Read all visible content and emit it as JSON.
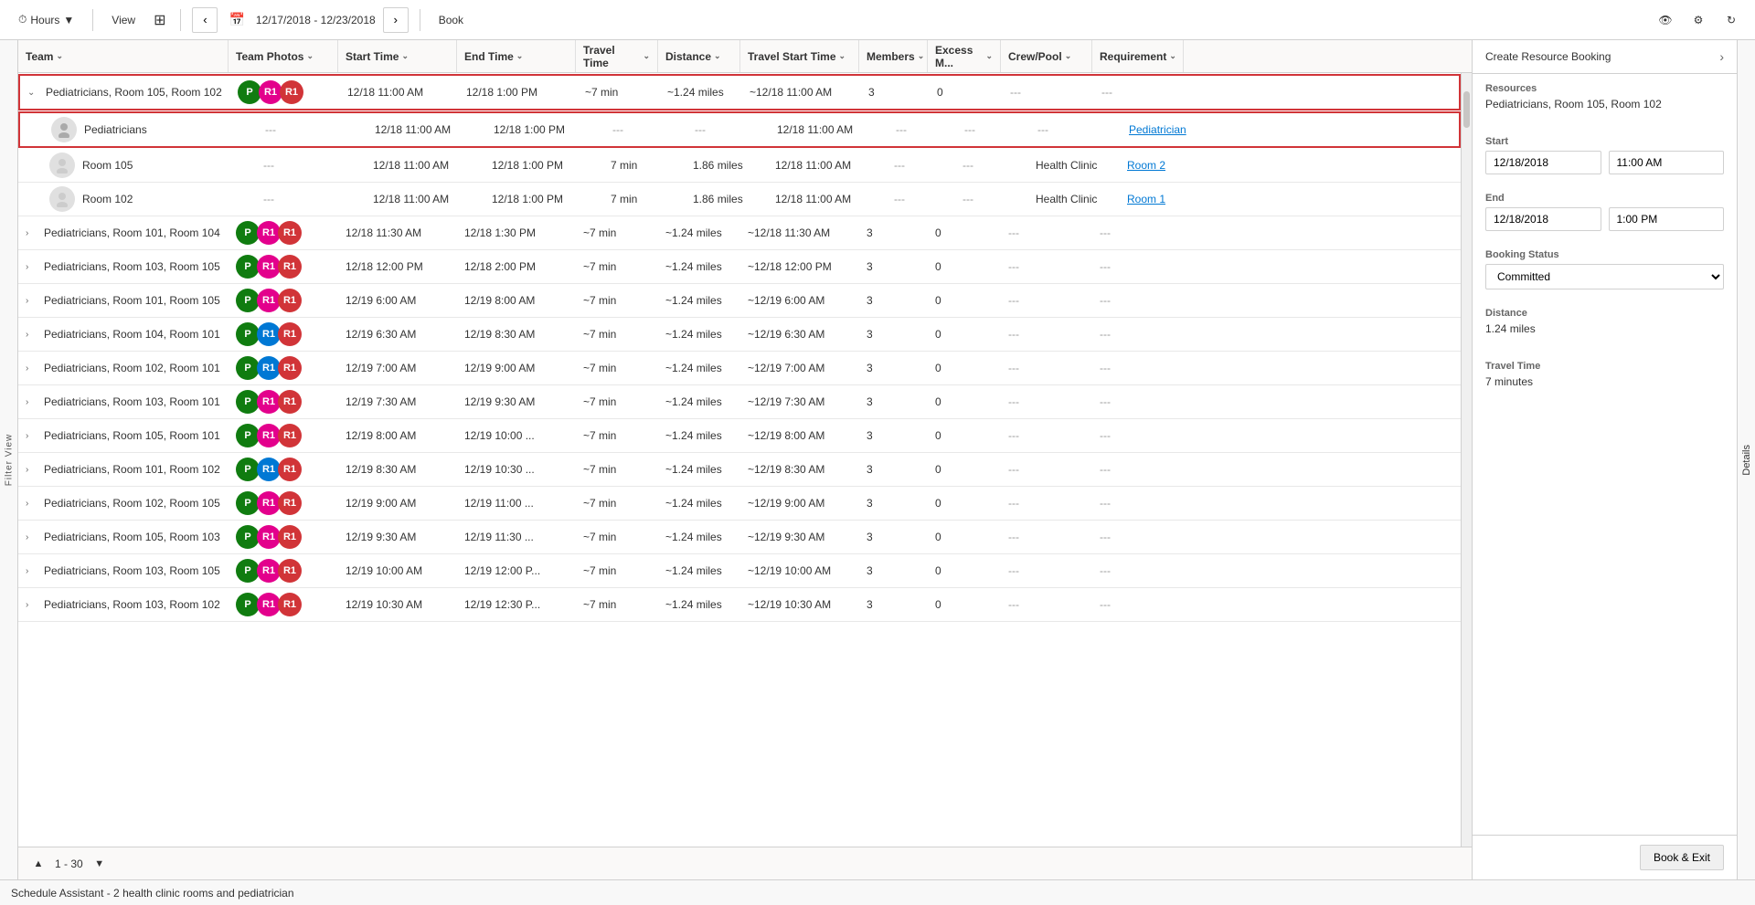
{
  "toolbar": {
    "hours_label": "Hours",
    "view_label": "View",
    "date_range": "12/17/2018 - 12/23/2018",
    "book_label": "Book",
    "prev_title": "Previous",
    "next_title": "Next"
  },
  "filter": {
    "label": "Filter View"
  },
  "grid": {
    "columns": [
      {
        "key": "team",
        "label": "Team"
      },
      {
        "key": "photos",
        "label": "Team Photos"
      },
      {
        "key": "start",
        "label": "Start Time"
      },
      {
        "key": "end",
        "label": "End Time"
      },
      {
        "key": "travel",
        "label": "Travel Time"
      },
      {
        "key": "distance",
        "label": "Distance"
      },
      {
        "key": "travelstart",
        "label": "Travel Start Time"
      },
      {
        "key": "members",
        "label": "Members"
      },
      {
        "key": "excess",
        "label": "Excess M..."
      },
      {
        "key": "crew",
        "label": "Crew/Pool"
      },
      {
        "key": "req",
        "label": "Requirement"
      }
    ],
    "rows": [
      {
        "id": "row1",
        "type": "group",
        "expanded": true,
        "team": "Pediatricians, Room 105, Room 102",
        "avatars": [
          {
            "color": "green",
            "letter": "P"
          },
          {
            "color": "pink",
            "letter": "R1"
          },
          {
            "color": "red",
            "letter": "R1"
          }
        ],
        "start": "12/18 11:00 AM",
        "end": "12/18 1:00 PM",
        "travel": "~7 min",
        "distance": "~1.24 miles",
        "travelstart": "~12/18 11:00 AM",
        "members": "3",
        "excess": "0",
        "crew": "---",
        "req": "---",
        "children": [
          {
            "id": "row1a",
            "type": "child-selected",
            "team": "Pediatricians",
            "avatars": [],
            "start": "12/18 11:00 AM",
            "end": "12/18 1:00 PM",
            "travel": "---",
            "distance": "---",
            "travelstart": "12/18 11:00 AM",
            "members": "---",
            "excess": "---",
            "crew": "---",
            "req": "Pediatrician",
            "req_link": true
          },
          {
            "id": "row1b",
            "type": "child",
            "team": "Room 105",
            "avatars": [],
            "start": "12/18 11:00 AM",
            "end": "12/18 1:00 PM",
            "travel": "7 min",
            "distance": "1.86 miles",
            "travelstart": "12/18 11:00 AM",
            "members": "---",
            "excess": "---",
            "crew": "Health Clinic",
            "req": "Room 2",
            "req_link": true
          },
          {
            "id": "row1c",
            "type": "child",
            "team": "Room 102",
            "avatars": [],
            "start": "12/18 11:00 AM",
            "end": "12/18 1:00 PM",
            "travel": "7 min",
            "distance": "1.86 miles",
            "travelstart": "12/18 11:00 AM",
            "members": "---",
            "excess": "---",
            "crew": "Health Clinic",
            "req": "Room 1",
            "req_link": true
          }
        ]
      },
      {
        "id": "row2",
        "type": "group",
        "expanded": false,
        "team": "Pediatricians, Room 101, Room 104",
        "avatars": [
          {
            "color": "green",
            "letter": "P"
          },
          {
            "color": "pink",
            "letter": "R1"
          },
          {
            "color": "red",
            "letter": "R1"
          }
        ],
        "start": "12/18 11:30 AM",
        "end": "12/18 1:30 PM",
        "travel": "~7 min",
        "distance": "~1.24 miles",
        "travelstart": "~12/18 11:30 AM",
        "members": "3",
        "excess": "0",
        "crew": "---",
        "req": "---"
      },
      {
        "id": "row3",
        "type": "group",
        "expanded": false,
        "team": "Pediatricians, Room 103, Room 105",
        "avatars": [
          {
            "color": "green",
            "letter": "P"
          },
          {
            "color": "pink",
            "letter": "R1"
          },
          {
            "color": "red",
            "letter": "R1"
          }
        ],
        "start": "12/18 12:00 PM",
        "end": "12/18 2:00 PM",
        "travel": "~7 min",
        "distance": "~1.24 miles",
        "travelstart": "~12/18 12:00 PM",
        "members": "3",
        "excess": "0",
        "crew": "---",
        "req": "---"
      },
      {
        "id": "row4",
        "type": "group",
        "expanded": false,
        "team": "Pediatricians, Room 101, Room 105",
        "avatars": [
          {
            "color": "green",
            "letter": "P"
          },
          {
            "color": "pink",
            "letter": "R1"
          },
          {
            "color": "red",
            "letter": "R1"
          }
        ],
        "start": "12/19 6:00 AM",
        "end": "12/19 8:00 AM",
        "travel": "~7 min",
        "distance": "~1.24 miles",
        "travelstart": "~12/19 6:00 AM",
        "members": "3",
        "excess": "0",
        "crew": "---",
        "req": "---"
      },
      {
        "id": "row5",
        "type": "group",
        "expanded": false,
        "team": "Pediatricians, Room 104, Room 101",
        "avatars": [
          {
            "color": "green",
            "letter": "P"
          },
          {
            "color": "blue",
            "letter": "R1"
          },
          {
            "color": "red",
            "letter": "R1"
          }
        ],
        "start": "12/19 6:30 AM",
        "end": "12/19 8:30 AM",
        "travel": "~7 min",
        "distance": "~1.24 miles",
        "travelstart": "~12/19 6:30 AM",
        "members": "3",
        "excess": "0",
        "crew": "---",
        "req": "---"
      },
      {
        "id": "row6",
        "type": "group",
        "expanded": false,
        "team": "Pediatricians, Room 102, Room 101",
        "avatars": [
          {
            "color": "green",
            "letter": "P"
          },
          {
            "color": "blue",
            "letter": "R1"
          },
          {
            "color": "red",
            "letter": "R1"
          }
        ],
        "start": "12/19 7:00 AM",
        "end": "12/19 9:00 AM",
        "travel": "~7 min",
        "distance": "~1.24 miles",
        "travelstart": "~12/19 7:00 AM",
        "members": "3",
        "excess": "0",
        "crew": "---",
        "req": "---"
      },
      {
        "id": "row7",
        "type": "group",
        "expanded": false,
        "team": "Pediatricians, Room 103, Room 101",
        "avatars": [
          {
            "color": "green",
            "letter": "P"
          },
          {
            "color": "pink",
            "letter": "R1"
          },
          {
            "color": "red",
            "letter": "R1"
          }
        ],
        "start": "12/19 7:30 AM",
        "end": "12/19 9:30 AM",
        "travel": "~7 min",
        "distance": "~1.24 miles",
        "travelstart": "~12/19 7:30 AM",
        "members": "3",
        "excess": "0",
        "crew": "---",
        "req": "---"
      },
      {
        "id": "row8",
        "type": "group",
        "expanded": false,
        "team": "Pediatricians, Room 105, Room 101",
        "avatars": [
          {
            "color": "green",
            "letter": "P"
          },
          {
            "color": "pink",
            "letter": "R1"
          },
          {
            "color": "red",
            "letter": "R1"
          }
        ],
        "start": "12/19 8:00 AM",
        "end": "12/19 10:00 ...",
        "travel": "~7 min",
        "distance": "~1.24 miles",
        "travelstart": "~12/19 8:00 AM",
        "members": "3",
        "excess": "0",
        "crew": "---",
        "req": "---"
      },
      {
        "id": "row9",
        "type": "group",
        "expanded": false,
        "team": "Pediatricians, Room 101, Room 102",
        "avatars": [
          {
            "color": "green",
            "letter": "P"
          },
          {
            "color": "blue",
            "letter": "R1"
          },
          {
            "color": "red",
            "letter": "R1"
          }
        ],
        "start": "12/19 8:30 AM",
        "end": "12/19 10:30 ...",
        "travel": "~7 min",
        "distance": "~1.24 miles",
        "travelstart": "~12/19 8:30 AM",
        "members": "3",
        "excess": "0",
        "crew": "---",
        "req": "---"
      },
      {
        "id": "row10",
        "type": "group",
        "expanded": false,
        "team": "Pediatricians, Room 102, Room 105",
        "avatars": [
          {
            "color": "green",
            "letter": "P"
          },
          {
            "color": "pink",
            "letter": "R1"
          },
          {
            "color": "red",
            "letter": "R1"
          }
        ],
        "start": "12/19 9:00 AM",
        "end": "12/19 11:00 ...",
        "travel": "~7 min",
        "distance": "~1.24 miles",
        "travelstart": "~12/19 9:00 AM",
        "members": "3",
        "excess": "0",
        "crew": "---",
        "req": "---"
      },
      {
        "id": "row11",
        "type": "group",
        "expanded": false,
        "team": "Pediatricians, Room 105, Room 103",
        "avatars": [
          {
            "color": "green",
            "letter": "P"
          },
          {
            "color": "pink",
            "letter": "R1"
          },
          {
            "color": "red",
            "letter": "R1"
          }
        ],
        "start": "12/19 9:30 AM",
        "end": "12/19 11:30 ...",
        "travel": "~7 min",
        "distance": "~1.24 miles",
        "travelstart": "~12/19 9:30 AM",
        "members": "3",
        "excess": "0",
        "crew": "---",
        "req": "---"
      },
      {
        "id": "row12",
        "type": "group",
        "expanded": false,
        "team": "Pediatricians, Room 103, Room 105",
        "avatars": [
          {
            "color": "green",
            "letter": "P"
          },
          {
            "color": "pink",
            "letter": "R1"
          },
          {
            "color": "red",
            "letter": "R1"
          }
        ],
        "start": "12/19 10:00 AM",
        "end": "12/19 12:00 P...",
        "travel": "~7 min",
        "distance": "~1.24 miles",
        "travelstart": "~12/19 10:00 AM",
        "members": "3",
        "excess": "0",
        "crew": "---",
        "req": "---"
      },
      {
        "id": "row13",
        "type": "group",
        "expanded": false,
        "team": "Pediatricians, Room 103, Room 102",
        "avatars": [
          {
            "color": "green",
            "letter": "P"
          },
          {
            "color": "pink",
            "letter": "R1"
          },
          {
            "color": "red",
            "letter": "R1"
          }
        ],
        "start": "12/19 10:30 AM",
        "end": "12/19 12:30 P...",
        "travel": "~7 min",
        "distance": "~1.24 miles",
        "travelstart": "~12/19 10:30 AM",
        "members": "3",
        "excess": "0",
        "crew": "---",
        "req": "---"
      }
    ],
    "pagination": {
      "current": "1 - 30"
    }
  },
  "right_panel": {
    "title": "Create Resource Booking",
    "resources_label": "Resources",
    "resources_value": "Pediatricians, Room 105, Room 102",
    "start_label": "Start",
    "start_date": "12/18/2018",
    "start_time": "11:00 AM",
    "end_label": "End",
    "end_date": "12/18/2018",
    "end_time": "1:00 PM",
    "booking_status_label": "Booking Status",
    "booking_status_value": "Committed",
    "distance_label": "Distance",
    "distance_value": "1.24 miles",
    "travel_time_label": "Travel Time",
    "travel_time_value": "7 minutes",
    "book_exit_label": "Book & Exit"
  },
  "details_tab": {
    "label": "Details"
  },
  "status_bar": {
    "text": "Schedule Assistant - 2 health clinic rooms and pediatrician"
  },
  "colors": {
    "accent": "#0078d4",
    "border_selected": "#e00000",
    "green": "#107c10",
    "pink": "#e3008c",
    "red": "#d13438",
    "blue": "#0078d4"
  }
}
